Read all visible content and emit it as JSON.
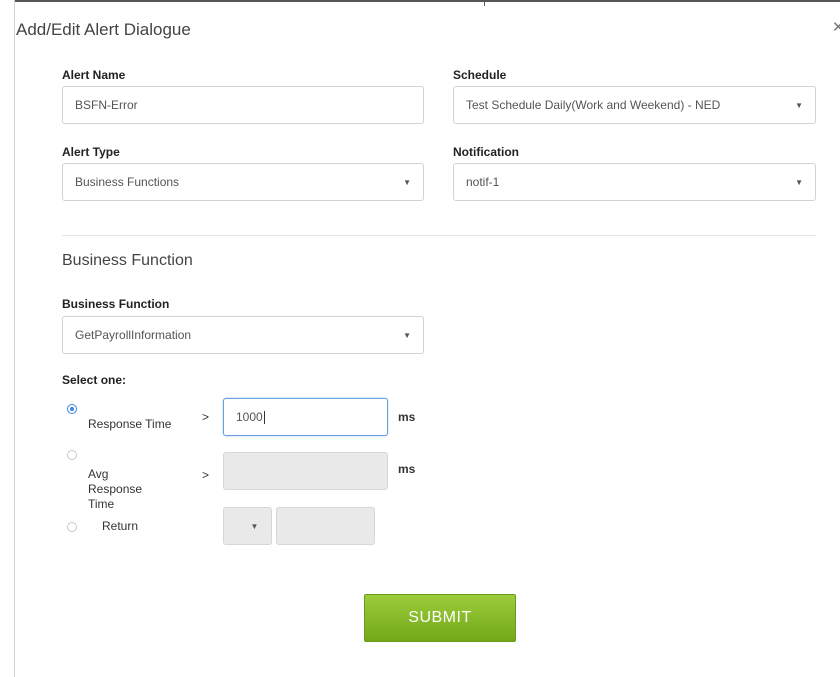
{
  "dialog": {
    "title": "Add/Edit Alert Dialogue",
    "close_icon": "close-icon"
  },
  "alert_name": {
    "label": "Alert Name",
    "value": "BSFN-Error"
  },
  "schedule": {
    "label": "Schedule",
    "value": "Test Schedule Daily(Work and Weekend) - NED"
  },
  "alert_type": {
    "label": "Alert Type",
    "value": "Business Functions"
  },
  "notification": {
    "label": "Notification",
    "value": "notif-1"
  },
  "business_function_section": {
    "title": "Business Function",
    "field_label": "Business Function",
    "value": "GetPayrollInformation"
  },
  "select_one": {
    "label": "Select one:",
    "options": [
      {
        "label": "Response Time",
        "selected": true,
        "value": "1000",
        "unit": "ms"
      },
      {
        "label": "Avg Response Time",
        "selected": false,
        "value": "",
        "unit": "ms"
      },
      {
        "label": "Return",
        "selected": false,
        "value": ""
      }
    ],
    "chevron": ">"
  },
  "submit_label": "SUBMIT",
  "colors": {
    "submit_green": "#8bc12f",
    "radio_blue": "#3a86e0"
  }
}
